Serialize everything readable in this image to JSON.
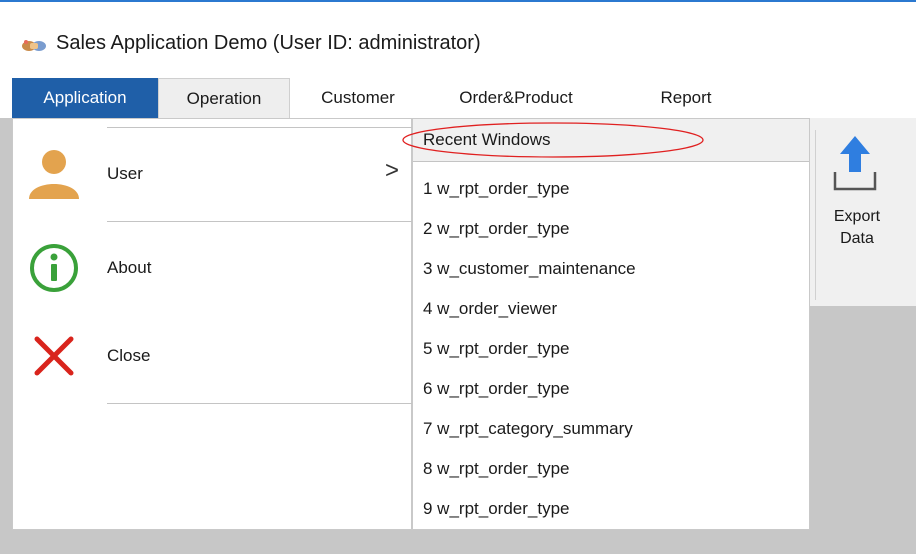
{
  "window": {
    "title": "Sales Application Demo (User ID: administrator)",
    "icon": "handshake-icon"
  },
  "menubar": {
    "tabs": [
      {
        "label": "Application",
        "state": "active"
      },
      {
        "label": "Operation",
        "state": "highlighted"
      },
      {
        "label": "Customer",
        "state": "normal"
      },
      {
        "label": "Order&Product",
        "state": "normal"
      },
      {
        "label": "Report",
        "state": "normal"
      }
    ]
  },
  "app_panel": {
    "items": [
      {
        "label": "User",
        "icon": "user-icon",
        "has_submenu": true
      },
      {
        "label": "About",
        "icon": "info-icon",
        "has_submenu": false
      },
      {
        "label": "Close",
        "icon": "close-icon",
        "has_submenu": false
      }
    ],
    "submenu_arrow": ">"
  },
  "recent_windows": {
    "header": "Recent Windows",
    "items": [
      "1 w_rpt_order_type",
      "2 w_rpt_order_type",
      "3 w_customer_maintenance",
      "4 w_order_viewer",
      "5 w_rpt_order_type",
      "6 w_rpt_order_type",
      "7 w_rpt_category_summary",
      "8 w_rpt_order_type",
      "9 w_rpt_order_type"
    ]
  },
  "ribbon": {
    "export": {
      "line1": "Export",
      "line2": "Data",
      "icon": "export-upload-icon"
    }
  },
  "colors": {
    "menu_active": "#1f5fa8",
    "workspace": "#c7c7c7",
    "user_icon": "#e3a34e",
    "info_icon": "#3aa13a",
    "close_icon": "#d9241c",
    "export_arrow": "#2f7ee0",
    "annotation_ellipse": "#e02020"
  }
}
